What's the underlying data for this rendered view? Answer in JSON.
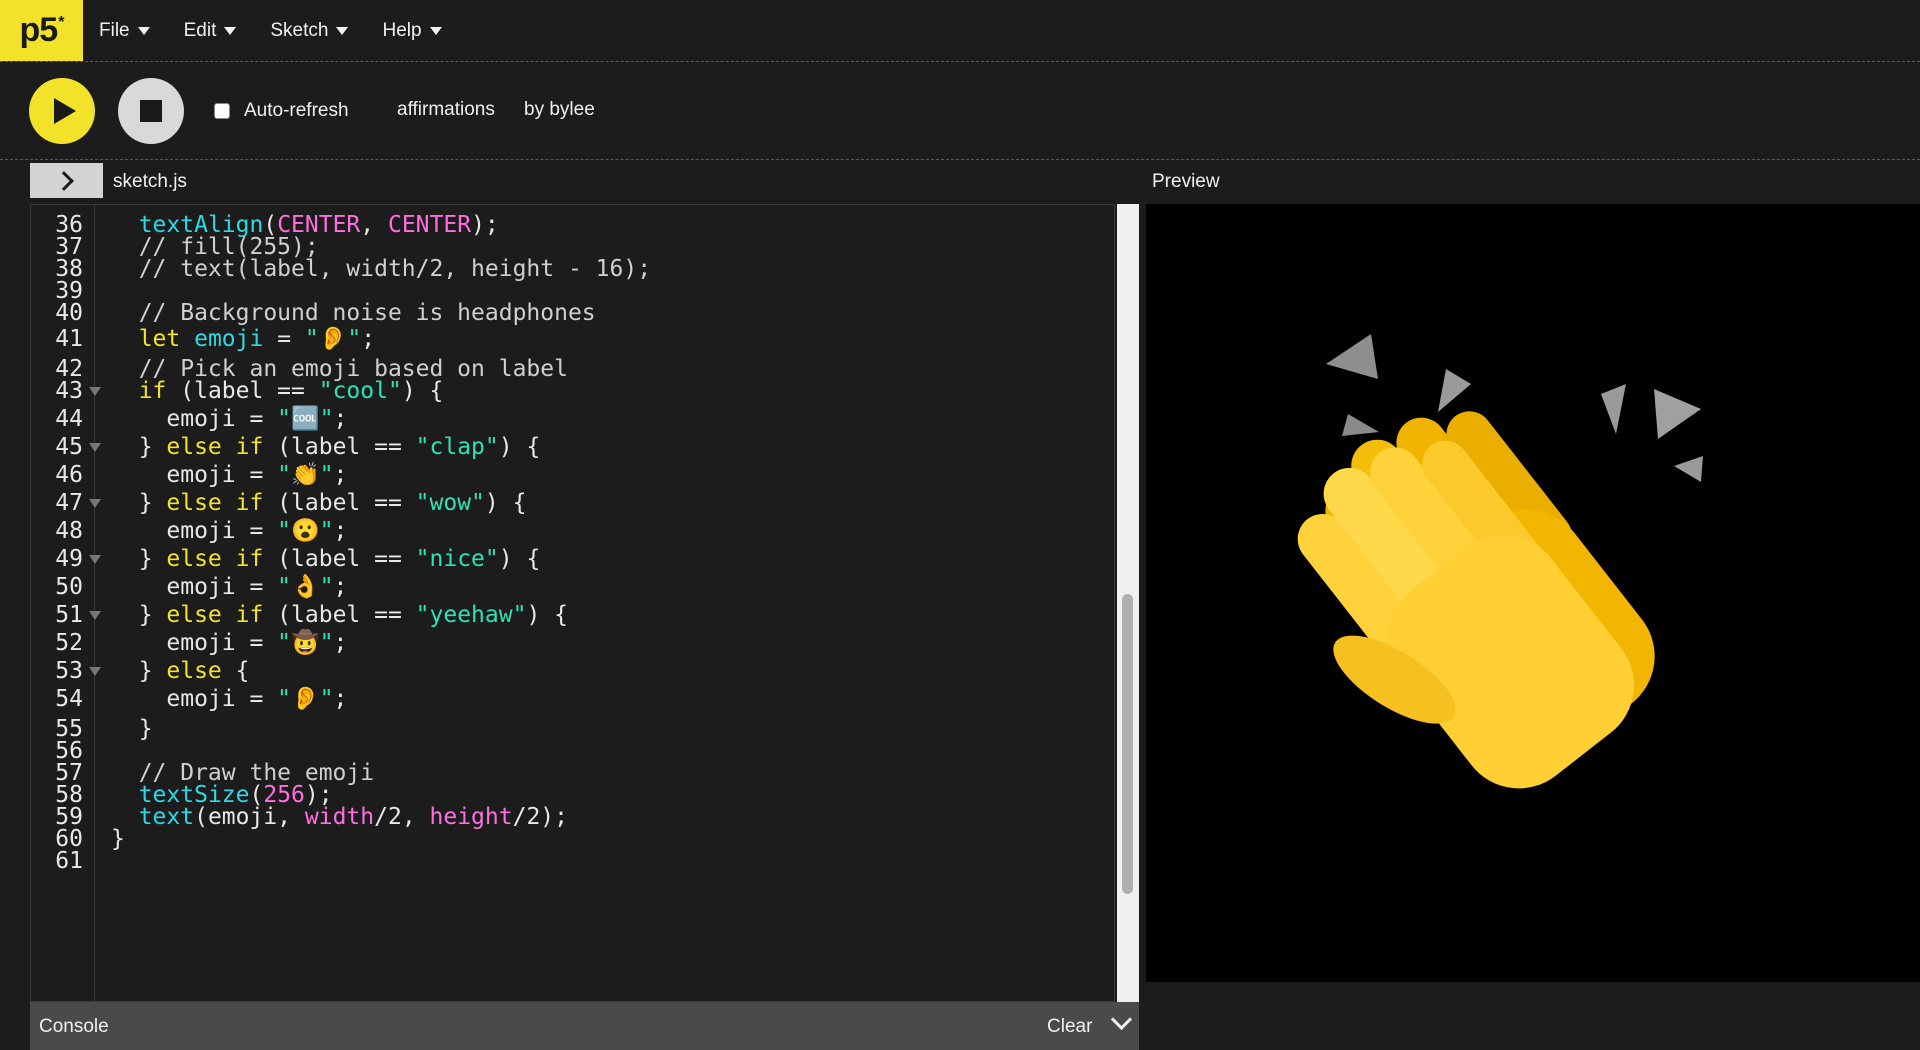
{
  "nav": {
    "logo": "p5",
    "logo_sup": "*",
    "menu": [
      "File",
      "Edit",
      "Sketch",
      "Help"
    ]
  },
  "toolbar": {
    "auto_refresh_label": "Auto-refresh",
    "auto_refresh_checked": false,
    "sketch_name": "affirmations",
    "author": "by bylee"
  },
  "editor": {
    "file_name": "sketch.js",
    "preview_label": "Preview",
    "lines": [
      {
        "n": "36",
        "fold": false,
        "parts": [
          [
            "  ",
            ""
          ],
          [
            "textAlign",
            "fn"
          ],
          [
            "(",
            ""
          ],
          [
            "CENTER",
            "const"
          ],
          [
            ", ",
            ""
          ],
          [
            "CENTER",
            "const"
          ],
          [
            ");",
            ""
          ]
        ]
      },
      {
        "n": "37",
        "fold": false,
        "parts": [
          [
            "  // fill(255);",
            "com"
          ]
        ]
      },
      {
        "n": "38",
        "fold": false,
        "parts": [
          [
            "  // text(label, width/2, height - 16);",
            "com"
          ]
        ]
      },
      {
        "n": "39",
        "fold": false,
        "parts": [
          [
            "",
            ""
          ]
        ]
      },
      {
        "n": "40",
        "fold": false,
        "parts": [
          [
            "  // Background noise is headphones",
            "com"
          ]
        ]
      },
      {
        "n": "41",
        "fold": false,
        "parts": [
          [
            "  ",
            ""
          ],
          [
            "let",
            "kw"
          ],
          [
            " ",
            ""
          ],
          [
            "emoji",
            "fn"
          ],
          [
            " = ",
            ""
          ],
          [
            "\"👂\"",
            "str"
          ],
          [
            ";",
            ""
          ]
        ]
      },
      {
        "n": "42",
        "fold": false,
        "parts": [
          [
            "  // Pick an emoji based on label",
            "com"
          ]
        ]
      },
      {
        "n": "43",
        "fold": true,
        "parts": [
          [
            "  ",
            ""
          ],
          [
            "if",
            "kw"
          ],
          [
            " (label == ",
            ""
          ],
          [
            "\"cool\"",
            "str"
          ],
          [
            ") {",
            ""
          ]
        ]
      },
      {
        "n": "44",
        "fold": false,
        "parts": [
          [
            "    emoji = ",
            ""
          ],
          [
            "\"🆒\"",
            "str"
          ],
          [
            ";",
            ""
          ]
        ]
      },
      {
        "n": "45",
        "fold": true,
        "parts": [
          [
            "  } ",
            ""
          ],
          [
            "else if",
            "kw"
          ],
          [
            " (label == ",
            ""
          ],
          [
            "\"clap\"",
            "str"
          ],
          [
            ") {",
            ""
          ]
        ]
      },
      {
        "n": "46",
        "fold": false,
        "parts": [
          [
            "    emoji = ",
            ""
          ],
          [
            "\"👏\"",
            "str"
          ],
          [
            ";",
            ""
          ]
        ]
      },
      {
        "n": "47",
        "fold": true,
        "parts": [
          [
            "  } ",
            ""
          ],
          [
            "else if",
            "kw"
          ],
          [
            " (label == ",
            ""
          ],
          [
            "\"wow\"",
            "str"
          ],
          [
            ") {",
            ""
          ]
        ]
      },
      {
        "n": "48",
        "fold": false,
        "parts": [
          [
            "    emoji = ",
            ""
          ],
          [
            "\"😮\"",
            "str"
          ],
          [
            ";",
            ""
          ]
        ]
      },
      {
        "n": "49",
        "fold": true,
        "parts": [
          [
            "  } ",
            ""
          ],
          [
            "else if",
            "kw"
          ],
          [
            " (label == ",
            ""
          ],
          [
            "\"nice\"",
            "str"
          ],
          [
            ") {",
            ""
          ]
        ]
      },
      {
        "n": "50",
        "fold": false,
        "parts": [
          [
            "    emoji = ",
            ""
          ],
          [
            "\"👌\"",
            "str"
          ],
          [
            ";",
            ""
          ]
        ]
      },
      {
        "n": "51",
        "fold": true,
        "parts": [
          [
            "  } ",
            ""
          ],
          [
            "else if",
            "kw"
          ],
          [
            " (label == ",
            ""
          ],
          [
            "\"yeehaw\"",
            "str"
          ],
          [
            ") {",
            ""
          ]
        ]
      },
      {
        "n": "52",
        "fold": false,
        "parts": [
          [
            "    emoji = ",
            ""
          ],
          [
            "\"🤠\"",
            "str"
          ],
          [
            ";",
            ""
          ]
        ]
      },
      {
        "n": "53",
        "fold": true,
        "parts": [
          [
            "  } ",
            ""
          ],
          [
            "else",
            "kw"
          ],
          [
            " {",
            ""
          ]
        ]
      },
      {
        "n": "54",
        "fold": false,
        "parts": [
          [
            "    emoji = ",
            ""
          ],
          [
            "\"👂\"",
            "str"
          ],
          [
            ";",
            ""
          ]
        ]
      },
      {
        "n": "55",
        "fold": false,
        "parts": [
          [
            "  }",
            ""
          ]
        ]
      },
      {
        "n": "56",
        "fold": false,
        "parts": [
          [
            "",
            ""
          ]
        ]
      },
      {
        "n": "57",
        "fold": false,
        "parts": [
          [
            "  // Draw the emoji",
            "com"
          ]
        ]
      },
      {
        "n": "58",
        "fold": false,
        "parts": [
          [
            "  ",
            ""
          ],
          [
            "textSize",
            "fn"
          ],
          [
            "(",
            ""
          ],
          [
            "256",
            "const"
          ],
          [
            ");",
            ""
          ]
        ]
      },
      {
        "n": "59",
        "fold": false,
        "parts": [
          [
            "  ",
            ""
          ],
          [
            "text",
            "fn"
          ],
          [
            "(emoji, ",
            ""
          ],
          [
            "width",
            "const"
          ],
          [
            "/2, ",
            ""
          ],
          [
            "height",
            "const"
          ],
          [
            "/2);",
            ""
          ]
        ]
      },
      {
        "n": "60",
        "fold": false,
        "parts": [
          [
            "}",
            ""
          ]
        ]
      },
      {
        "n": "61",
        "fold": false,
        "parts": [
          [
            "",
            ""
          ]
        ]
      }
    ]
  },
  "console": {
    "title": "Console",
    "clear_label": "Clear"
  },
  "preview": {
    "emoji_icon": "clapping-hands"
  },
  "colors": {
    "accent": "#f2e32a",
    "background": "#1c1c1c",
    "fn": "#2ed9e3",
    "keyword": "#f2e32a",
    "string": "#2ee3b3",
    "constant": "#ff6ee0"
  }
}
